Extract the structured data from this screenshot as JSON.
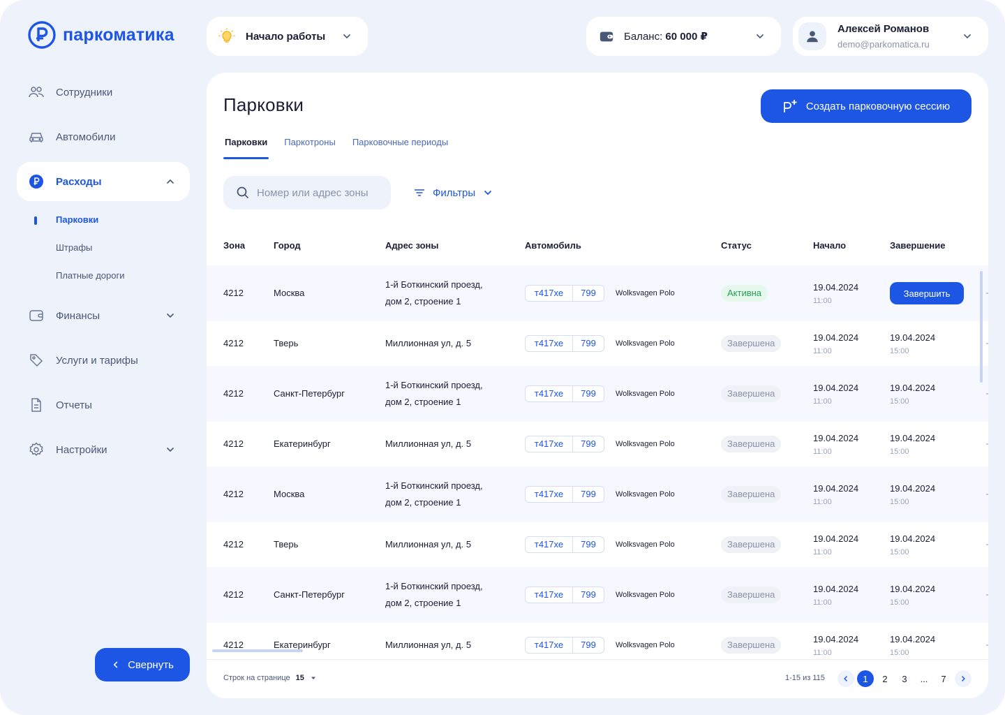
{
  "brand": {
    "name": "паркоматика",
    "color": "#1d55e5"
  },
  "topbar": {
    "start": {
      "label": "Начало работы",
      "icon": "lightbulb-icon"
    },
    "balance": {
      "prefix": "Баланс:",
      "value": "60 000 ₽",
      "icon": "wallet-icon"
    },
    "user": {
      "name": "Алексей Романов",
      "email": "demo@parkomatica.ru",
      "icon": "user-icon"
    }
  },
  "sidebar": {
    "items": [
      {
        "label": "Сотрудники",
        "icon": "users-icon"
      },
      {
        "label": "Автомобили",
        "icon": "car-icon"
      },
      {
        "label": "Расходы",
        "icon": "ruble-icon",
        "active": true,
        "expanded": true
      },
      {
        "label": "Финансы",
        "icon": "wallet-icon"
      },
      {
        "label": "Услуги и тарифы",
        "icon": "tag-icon"
      },
      {
        "label": "Отчеты",
        "icon": "document-icon"
      },
      {
        "label": "Настройки",
        "icon": "gear-icon"
      }
    ],
    "subitems": [
      {
        "label": "Парковки",
        "active": true
      },
      {
        "label": "Штрафы"
      },
      {
        "label": "Платные дороги"
      }
    ],
    "collapse_label": "Свернуть"
  },
  "main": {
    "title": "Парковки",
    "create_label": "Создать парковочную сессию",
    "tabs": [
      {
        "label": "Парковки",
        "active": true
      },
      {
        "label": "Паркотроны"
      },
      {
        "label": "Парковочные периоды"
      }
    ],
    "search_placeholder": "Номер или адрес зоны",
    "filters_label": "Фильтры"
  },
  "table": {
    "columns": [
      "Зона",
      "Город",
      "Адрес зоны",
      "Автомобиль",
      "Статус",
      "Начало",
      "Завершение"
    ],
    "finish_label": "Завершить",
    "rows": [
      {
        "zone": "4212",
        "city": "Москва",
        "addr1": "1-й Боткинский проезд,",
        "addr2": "дом 2, строение 1",
        "plate": "т417хе",
        "region": "799",
        "car": "Wolksvagen Polo",
        "status": "Активна",
        "status_kind": "active",
        "start_date": "19.04.2024",
        "start_time": "11:00",
        "end_date": "",
        "end_time": ""
      },
      {
        "zone": "4212",
        "city": "Тверь",
        "addr1": "Миллионная ул, д. 5",
        "addr2": "",
        "plate": "т417хе",
        "region": "799",
        "car": "Wolksvagen Polo",
        "status": "Завершена",
        "status_kind": "done",
        "start_date": "19.04.2024",
        "start_time": "11:00",
        "end_date": "19.04.2024",
        "end_time": "15:00"
      },
      {
        "zone": "4212",
        "city": "Санкт-Петербург",
        "addr1": "1-й Боткинский проезд,",
        "addr2": "дом 2, строение 1",
        "plate": "т417хе",
        "region": "799",
        "car": "Wolksvagen Polo",
        "status": "Завершена",
        "status_kind": "done",
        "start_date": "19.04.2024",
        "start_time": "11:00",
        "end_date": "19.04.2024",
        "end_time": "15:00"
      },
      {
        "zone": "4212",
        "city": "Екатеринбург",
        "addr1": "Миллионная ул, д. 5",
        "addr2": "",
        "plate": "т417хе",
        "region": "799",
        "car": "Wolksvagen Polo",
        "status": "Завершена",
        "status_kind": "done",
        "start_date": "19.04.2024",
        "start_time": "11:00",
        "end_date": "19.04.2024",
        "end_time": "15:00"
      },
      {
        "zone": "4212",
        "city": "Москва",
        "addr1": "1-й Боткинский проезд,",
        "addr2": "дом 2, строение 1",
        "plate": "т417хе",
        "region": "799",
        "car": "Wolksvagen Polo",
        "status": "Завершена",
        "status_kind": "done",
        "start_date": "19.04.2024",
        "start_time": "11:00",
        "end_date": "19.04.2024",
        "end_time": "15:00"
      },
      {
        "zone": "4212",
        "city": "Тверь",
        "addr1": "Миллионная ул, д. 5",
        "addr2": "",
        "plate": "т417хе",
        "region": "799",
        "car": "Wolksvagen Polo",
        "status": "Завершена",
        "status_kind": "done",
        "start_date": "19.04.2024",
        "start_time": "11:00",
        "end_date": "19.04.2024",
        "end_time": "15:00"
      },
      {
        "zone": "4212",
        "city": "Санкт-Петербург",
        "addr1": "1-й Боткинский проезд,",
        "addr2": "дом 2, строение 1",
        "plate": "т417хе",
        "region": "799",
        "car": "Wolksvagen Polo",
        "status": "Завершена",
        "status_kind": "done",
        "start_date": "19.04.2024",
        "start_time": "11:00",
        "end_date": "19.04.2024",
        "end_time": "15:00"
      },
      {
        "zone": "4212",
        "city": "Екатеринбург",
        "addr1": "Миллионная ул, д. 5",
        "addr2": "",
        "plate": "т417хе",
        "region": "799",
        "car": "Wolksvagen Polo",
        "status": "Завершена",
        "status_kind": "done",
        "start_date": "19.04.2024",
        "start_time": "11:00",
        "end_date": "19.04.2024",
        "end_time": "15:00"
      }
    ]
  },
  "footer": {
    "rows_per_page_label": "Строк на странице",
    "rows_per_page_value": "15",
    "range": "1-15 из 115",
    "pages": [
      "1",
      "2",
      "3",
      "...",
      "7"
    ],
    "current_page": "1"
  }
}
